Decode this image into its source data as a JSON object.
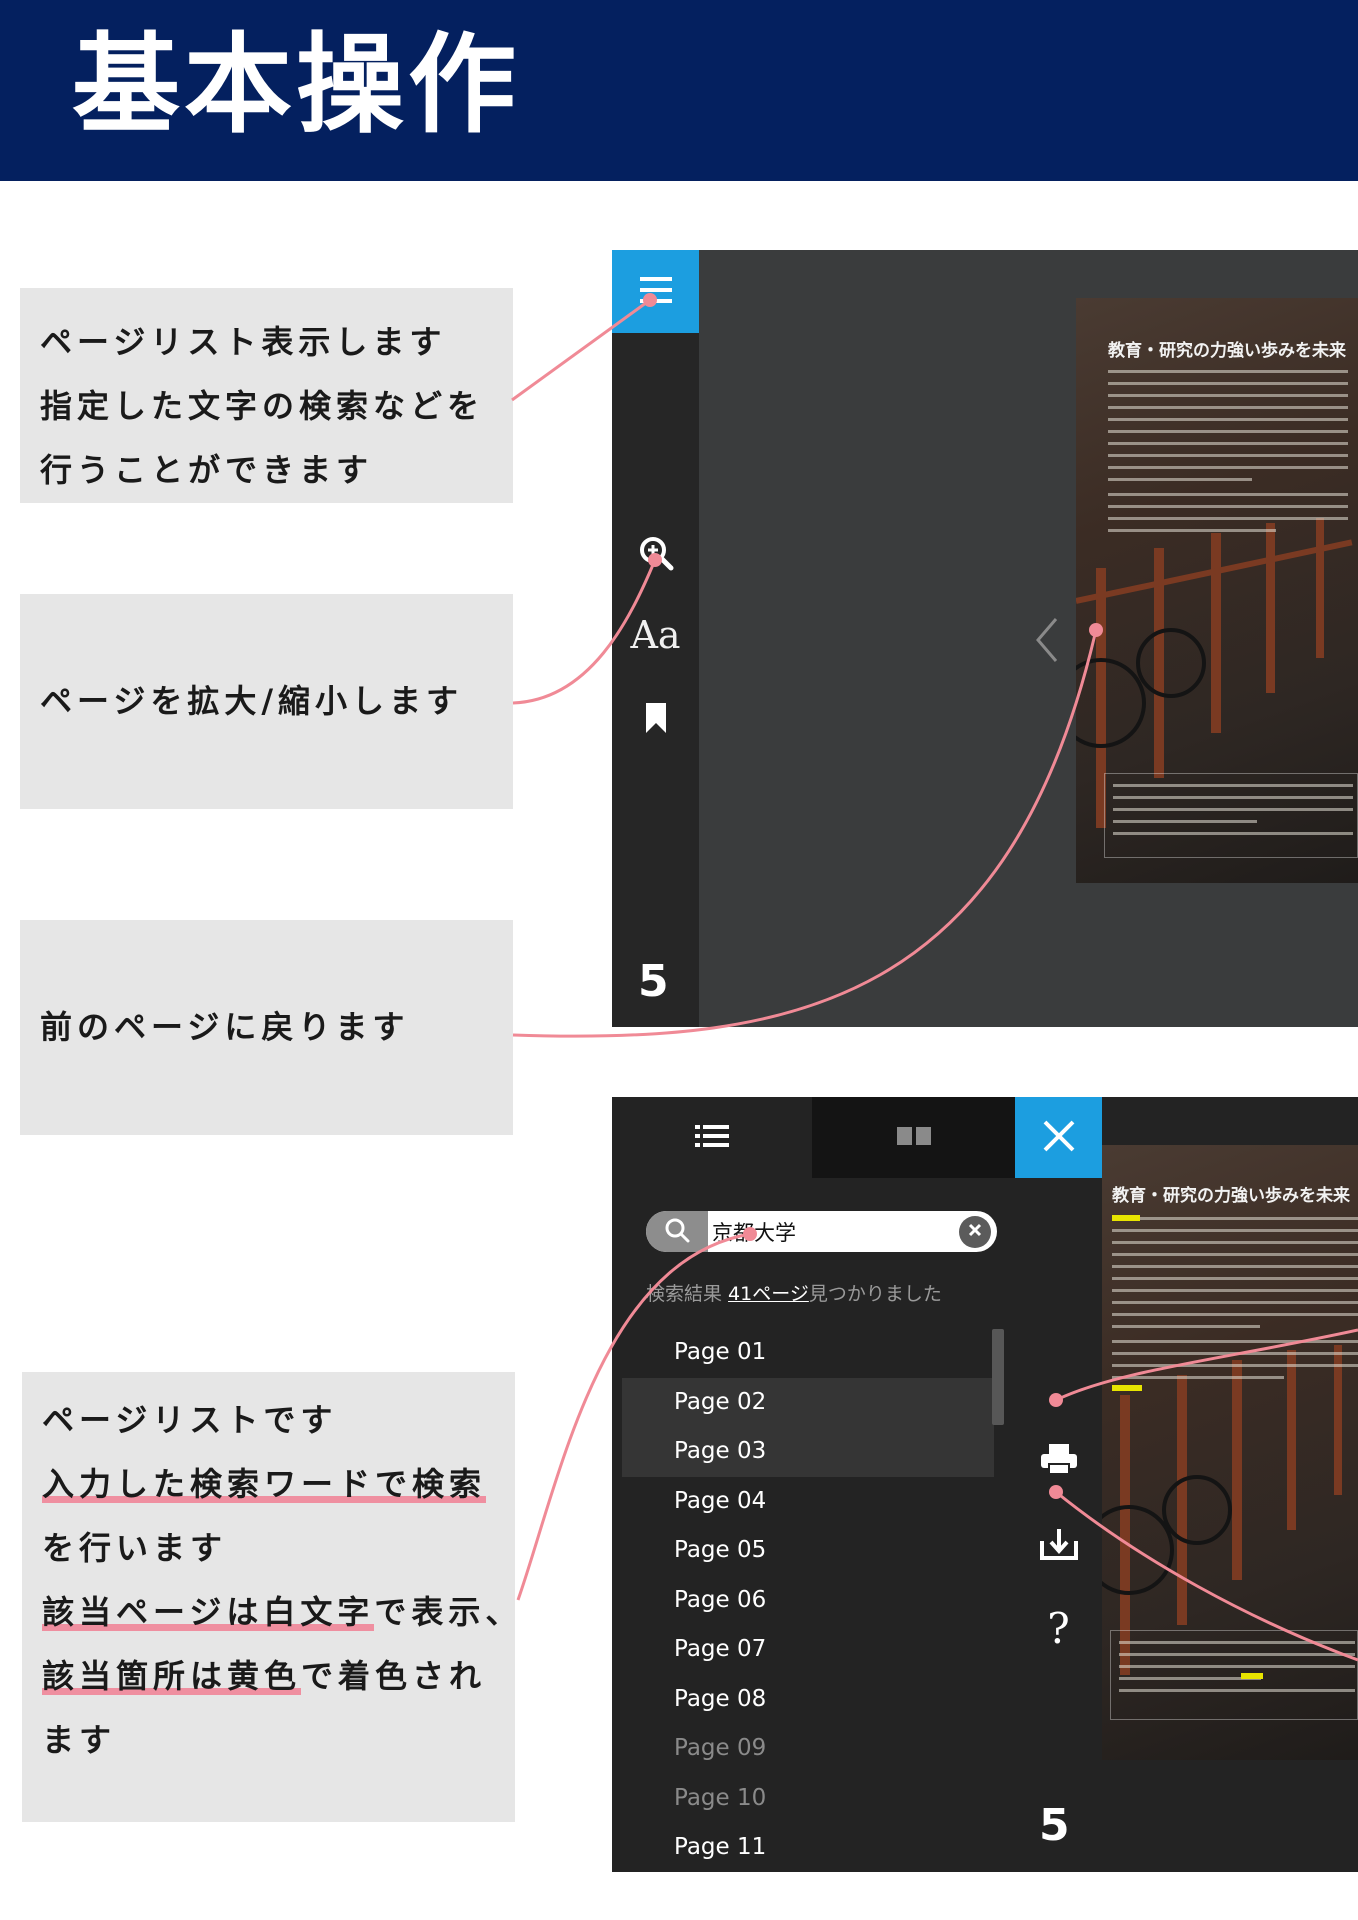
{
  "header": {
    "title": "基本操作",
    "bg_color": "#04205f"
  },
  "notes": {
    "page_list_search": [
      "ページリスト表示します",
      "指定した文字の検索などを",
      "行うことができます"
    ],
    "zoom": "ページを拡大/縮小します",
    "prev_page": "前のページに戻ります",
    "list_description": {
      "line1": "ページリストです",
      "line2": "入力した検索ワードで検索",
      "line3": "を行います",
      "line4_ul": "該当ページは白文字",
      "line4_rest": "で表示、",
      "line5_ul": "該当箇所は黄色",
      "line5_rest": "で着色され",
      "line6": "ます"
    }
  },
  "viewer1": {
    "page_number": "5",
    "page_heading": "教育・研究の力強い歩みを未来",
    "icons": [
      "menu-icon",
      "zoom-icon",
      "font-size-icon",
      "bookmark-icon",
      "prev-page-arrow-icon"
    ],
    "accent_color": "#1c9ee0"
  },
  "viewer2": {
    "tabs": [
      "list-tab",
      "thumbnail-tab",
      "close-tab"
    ],
    "search": {
      "value": "京都大学"
    },
    "result": {
      "prefix": "検索結果 ",
      "link": "41ページ",
      "suffix": "見つかりました"
    },
    "pages": [
      {
        "label": "Page 01",
        "selected": false,
        "dim": false
      },
      {
        "label": "Page 02",
        "selected": true,
        "dim": false
      },
      {
        "label": "Page 03",
        "selected": true,
        "dim": false
      },
      {
        "label": "Page 04",
        "selected": false,
        "dim": false
      },
      {
        "label": "Page 05",
        "selected": false,
        "dim": false
      },
      {
        "label": "Page 06",
        "selected": false,
        "dim": false
      },
      {
        "label": "Page 07",
        "selected": false,
        "dim": false
      },
      {
        "label": "Page 08",
        "selected": false,
        "dim": false
      },
      {
        "label": "Page 09",
        "selected": false,
        "dim": true
      },
      {
        "label": "Page 10",
        "selected": false,
        "dim": true
      },
      {
        "label": "Page 11",
        "selected": false,
        "dim": false
      }
    ],
    "tools": [
      "print-icon",
      "download-icon",
      "help-icon"
    ],
    "help_label": "?",
    "page_number": "5",
    "page_heading": "教育・研究の力強い歩みを未来"
  },
  "connector_color": "#f08a96"
}
